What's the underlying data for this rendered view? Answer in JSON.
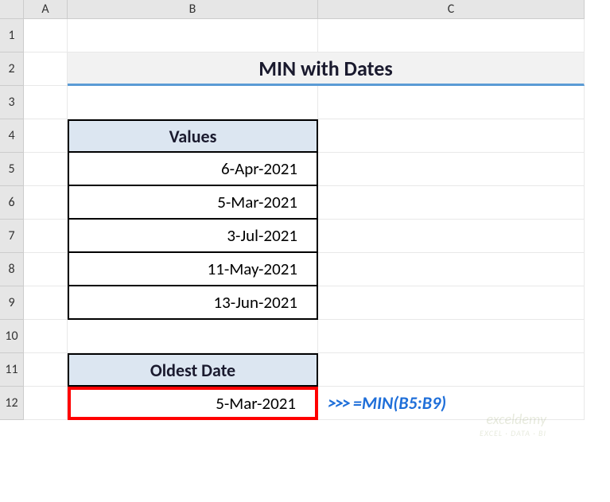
{
  "columns": [
    "A",
    "B",
    "C"
  ],
  "rows": [
    "1",
    "2",
    "3",
    "4",
    "5",
    "6",
    "7",
    "8",
    "9",
    "10",
    "11",
    "12"
  ],
  "title": "MIN with Dates",
  "values_header": "Values",
  "values": [
    "6-Apr-2021",
    "5-Mar-2021",
    "3-Jul-2021",
    "11-May-2021",
    "13-Jun-2021"
  ],
  "result_header": "Oldest Date",
  "result_value": "5-Mar-2021",
  "formula_prefix": ">>>",
  "formula_text": "=MIN(B5:B9)",
  "watermark": "exceldemy",
  "watermark_sub": "EXCEL · DATA · BI",
  "chart_data": {
    "type": "table",
    "title": "MIN with Dates",
    "columns": [
      "Values"
    ],
    "rows": [
      [
        "6-Apr-2021"
      ],
      [
        "5-Mar-2021"
      ],
      [
        "3-Jul-2021"
      ],
      [
        "11-May-2021"
      ],
      [
        "13-Jun-2021"
      ]
    ],
    "computed": {
      "label": "Oldest Date",
      "value": "5-Mar-2021",
      "formula": "=MIN(B5:B9)"
    }
  }
}
